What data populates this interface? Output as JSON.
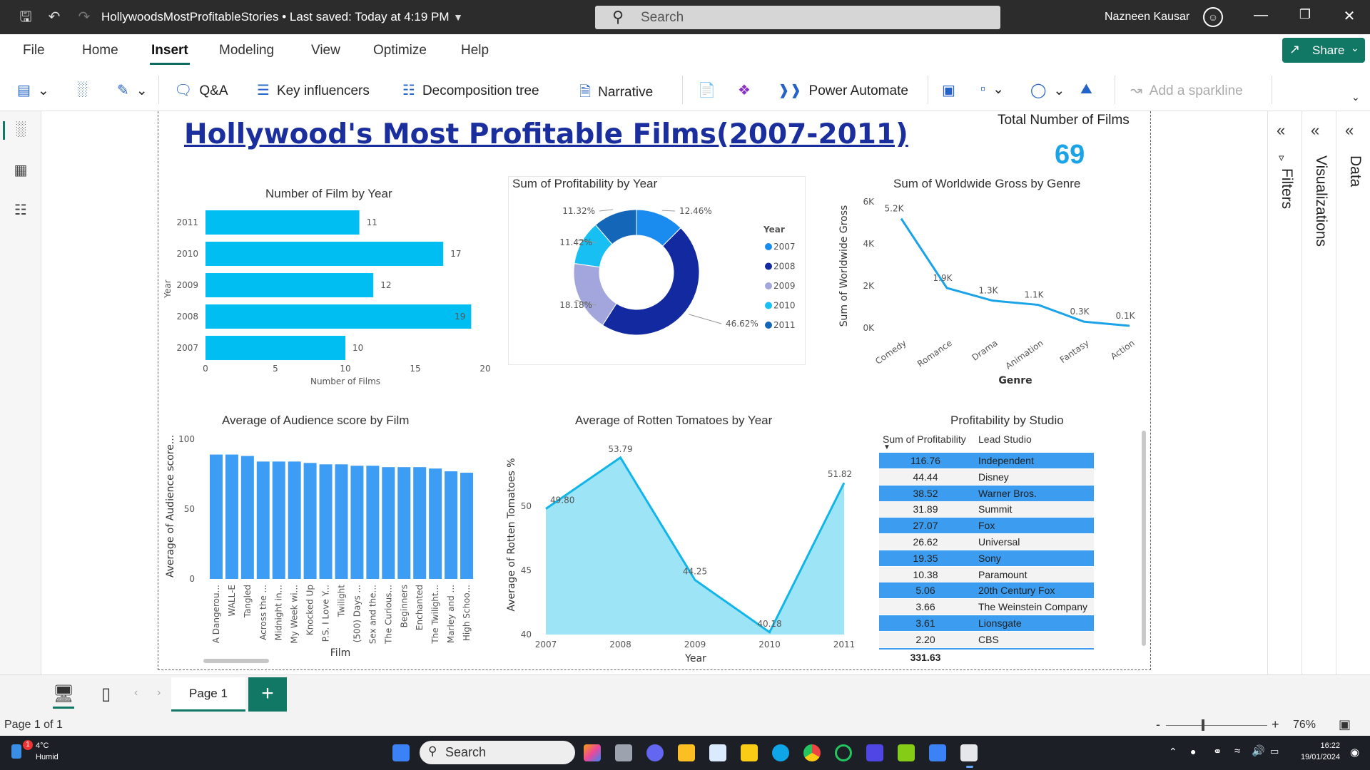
{
  "titlebar": {
    "doc_title": "HollywoodsMostProfitableStories • Last saved: Today at 4:19 PM",
    "search_placeholder": "Search",
    "user_name": "Nazneen Kausar"
  },
  "menu": {
    "items": [
      "File",
      "Home",
      "Insert",
      "Modeling",
      "View",
      "Optimize",
      "Help"
    ],
    "active": "Insert",
    "share_label": "Share"
  },
  "ribbon": {
    "qa": "Q&A",
    "key_influencers": "Key influencers",
    "decomposition_tree": "Decomposition tree",
    "narrative": "Narrative",
    "power_automate": "Power Automate",
    "sparkline": "Add a sparkline"
  },
  "report": {
    "title": "Hollywood's Most Profitable Films(2007-2011)",
    "total_label": "Total Number of Films",
    "total_value": "69"
  },
  "chart_data": [
    {
      "type": "bar",
      "orientation": "horizontal",
      "title": "Number of Film by Year",
      "categories": [
        "2011",
        "2010",
        "2009",
        "2008",
        "2007"
      ],
      "values": [
        11,
        17,
        12,
        19,
        10
      ],
      "xlabel": "Number of Films",
      "ylabel": "Year",
      "xlim": [
        0,
        20
      ],
      "xticks": [
        "0",
        "5",
        "10",
        "15",
        "20"
      ],
      "color": "#00bef2"
    },
    {
      "type": "pie",
      "title": "Sum of Profitability by Year",
      "legend_title": "Year",
      "categories": [
        "2007",
        "2008",
        "2009",
        "2010",
        "2011"
      ],
      "values": [
        12.46,
        46.62,
        18.18,
        11.42,
        11.32
      ],
      "labels": [
        "12.46%",
        "46.62%",
        "18.18%",
        "11.42%",
        "11.32%"
      ],
      "colors": [
        "#1a8cf0",
        "#1329a0",
        "#a3a6dc",
        "#18bff2",
        "#1466b8"
      ]
    },
    {
      "type": "line",
      "title": "Sum of Worldwide Gross by Genre",
      "categories": [
        "Comedy",
        "Romance",
        "Drama",
        "Animation",
        "Fantasy",
        "Action"
      ],
      "values": [
        5.2,
        1.9,
        1.3,
        1.1,
        0.3,
        0.1
      ],
      "labels": [
        "5.2K",
        "1.9K",
        "1.3K",
        "1.1K",
        "0.3K",
        "0.1K"
      ],
      "xlabel": "Genre",
      "ylabel": "Sum of Worldwide Gross",
      "ylim": [
        0,
        6
      ],
      "yticks": [
        "0K",
        "2K",
        "4K",
        "6K"
      ],
      "color": "#1ba3e8"
    },
    {
      "type": "bar",
      "title": "Average of Audience score by Film",
      "categories": [
        "A Dangerou...",
        "WALL-E",
        "Tangled",
        "Across the ...",
        "Midnight in...",
        "My Week wi...",
        "Knocked Up",
        "P.S. I Love Y...",
        "Twilight",
        "(500) Days ...",
        "Sex and the...",
        "The Curious...",
        "Beginners",
        "Enchanted",
        "The Twilight...",
        "Marley and ...",
        "High Schoo..."
      ],
      "values": [
        89,
        89,
        88,
        84,
        84,
        84,
        83,
        82,
        82,
        81,
        81,
        80,
        80,
        80,
        79,
        77,
        76
      ],
      "xlabel": "Film",
      "ylabel": "Average of Audience score...",
      "ylim": [
        0,
        100
      ],
      "yticks": [
        "0",
        "50",
        "100"
      ],
      "color": "#3d9df5"
    },
    {
      "type": "area",
      "title": "Average of Rotten Tomatoes by Year",
      "categories": [
        "2007",
        "2008",
        "2009",
        "2010",
        "2011"
      ],
      "values": [
        49.8,
        53.79,
        44.25,
        40.18,
        51.82
      ],
      "labels": [
        "49.80",
        "53.79",
        "44.25",
        "40.18",
        "51.82"
      ],
      "xlabel": "Year",
      "ylabel": "Average of Rotten Tomatoes %",
      "ylim": [
        40,
        55
      ],
      "yticks": [
        "40",
        "45",
        "50"
      ],
      "line_color": "#12b5e8",
      "fill_color": "#9de4f7"
    },
    {
      "type": "table",
      "title": "Profitability by Studio",
      "columns": [
        "Sum of Profitability",
        "Lead Studio"
      ],
      "rows": [
        [
          "116.76",
          "Independent"
        ],
        [
          "44.44",
          "Disney"
        ],
        [
          "38.52",
          "Warner Bros."
        ],
        [
          "31.89",
          "Summit"
        ],
        [
          "27.07",
          "Fox"
        ],
        [
          "26.62",
          "Universal"
        ],
        [
          "19.35",
          "Sony"
        ],
        [
          "10.38",
          "Paramount"
        ],
        [
          "5.06",
          "20th Century Fox"
        ],
        [
          "3.66",
          "The Weinstein Company"
        ],
        [
          "3.61",
          "Lionsgate"
        ],
        [
          "2.20",
          "CBS"
        ]
      ],
      "total": "331.63",
      "stripe_color": "#3b9cf0"
    }
  ],
  "panes": {
    "filters": "Filters",
    "visualizations": "Visualizations",
    "data": "Data"
  },
  "pages": {
    "tab": "Page 1"
  },
  "status": {
    "page": "Page 1 of 1",
    "zoom": "76%"
  },
  "taskbar": {
    "weather_temp": "4°C",
    "weather_desc": "Humid",
    "search": "Search",
    "time": "16:22",
    "date": "19/01/2024"
  }
}
